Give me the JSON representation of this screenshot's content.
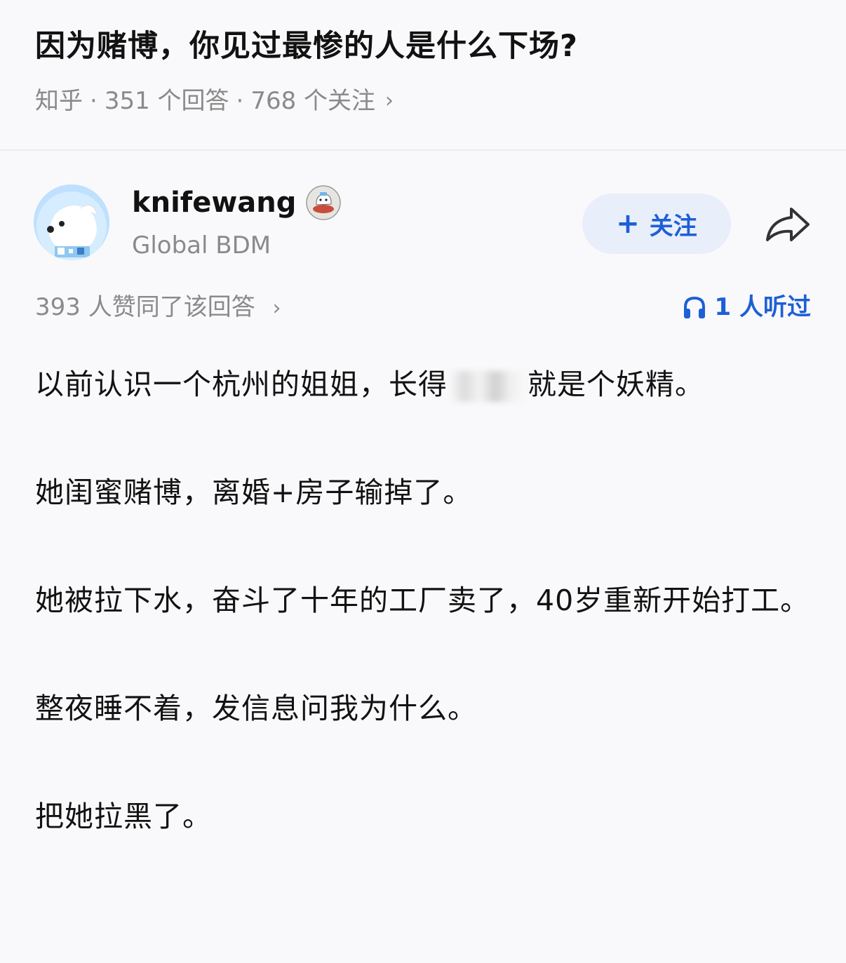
{
  "question": {
    "title": "因为赌博，你见过最惨的人是什么下场?",
    "source": "知乎",
    "answers": "351 个回答",
    "followers": "768 个关注"
  },
  "author": {
    "name": "knifewang",
    "headline": "Global BDM",
    "follow_label": "关注"
  },
  "stats": {
    "upvotes": "393 人赞同了该回答",
    "listens": "1 人听过"
  },
  "body": {
    "p1_before": "以前认识一个杭州的姐姐，长得",
    "p1_after": "就是个妖精。",
    "p2": "她闺蜜赌博，离婚+房子输掉了。",
    "p3": "她被拉下水，奋斗了十年的工厂卖了，40岁重新开始打工。",
    "p4": "整夜睡不着，发信息问我为什么。",
    "p5": "把她拉黑了。"
  },
  "colors": {
    "accent": "#1e5fd6",
    "follow_bg": "#e9eefb",
    "muted": "#8a8a8a",
    "background": "#f9f9fb"
  },
  "icons": [
    "chevron-right-icon",
    "badge-icon",
    "plus-icon",
    "share-icon",
    "headphones-icon"
  ]
}
